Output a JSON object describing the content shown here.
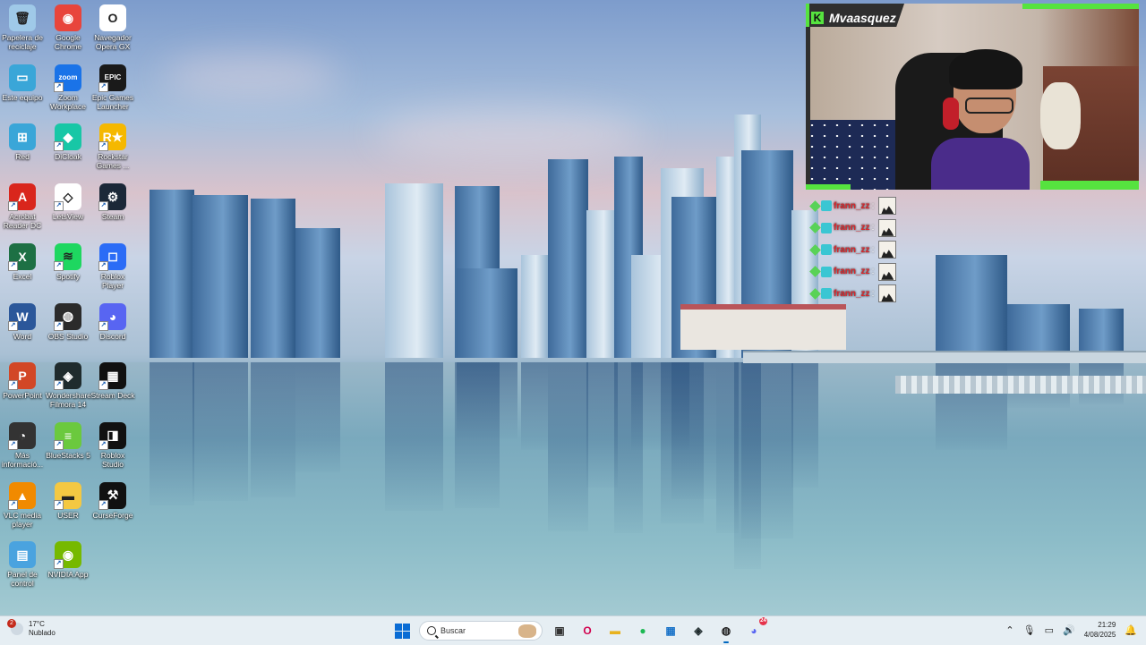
{
  "desktop": {
    "icons": [
      {
        "label": "Papelera de reciclaje",
        "icon": "recycle-bin-icon",
        "color": "#9fc9e8",
        "glyph": "🗑"
      },
      {
        "label": "Google Chrome",
        "icon": "chrome-icon",
        "color": "#e8453c",
        "glyph": "◉"
      },
      {
        "label": "Navegador Opera GX",
        "icon": "opera-gx-icon",
        "color": "#ffffff",
        "glyph": "O"
      },
      {
        "label": "Este equipo",
        "icon": "computer-icon",
        "color": "#3aa6d8",
        "glyph": "▭"
      },
      {
        "label": "Zoom Workplace",
        "icon": "zoom-icon",
        "color": "#1a73e8",
        "glyph": "zoom"
      },
      {
        "label": "Epic Games Launcher",
        "icon": "epic-games-icon",
        "color": "#1a1a1a",
        "glyph": "EPIC"
      },
      {
        "label": "Red",
        "icon": "network-icon",
        "color": "#3aa6d8",
        "glyph": "⊞"
      },
      {
        "label": "DiCloak",
        "icon": "dicloak-icon",
        "color": "#18c7a6",
        "glyph": "◆"
      },
      {
        "label": "Rockstar Games ...",
        "icon": "rockstar-icon",
        "color": "#f5b800",
        "glyph": "R★"
      },
      {
        "label": "Acrobat Reader DC",
        "icon": "acrobat-icon",
        "color": "#d9261c",
        "glyph": "A"
      },
      {
        "label": "LetsView",
        "icon": "letsview-icon",
        "color": "#ffffff",
        "glyph": "◇"
      },
      {
        "label": "Steam",
        "icon": "steam-icon",
        "color": "#1b2838",
        "glyph": "⚙"
      },
      {
        "label": "Excel",
        "icon": "excel-icon",
        "color": "#1d7044",
        "glyph": "X"
      },
      {
        "label": "Spotify",
        "icon": "spotify-icon",
        "color": "#1ed760",
        "glyph": "≋"
      },
      {
        "label": "Roblox Player",
        "icon": "roblox-icon",
        "color": "#2b6cf6",
        "glyph": "◻"
      },
      {
        "label": "Word",
        "icon": "word-icon",
        "color": "#2b579a",
        "glyph": "W"
      },
      {
        "label": "OBS Studio",
        "icon": "obs-icon",
        "color": "#2b2b2b",
        "glyph": "◍"
      },
      {
        "label": "Discord",
        "icon": "discord-icon",
        "color": "#5865f2",
        "glyph": "◕"
      },
      {
        "label": "PowerPoint",
        "icon": "powerpoint-icon",
        "color": "#d24726",
        "glyph": "P"
      },
      {
        "label": "Wondershare Filmora 14",
        "icon": "filmora-icon",
        "color": "#1f2b2d",
        "glyph": "◈"
      },
      {
        "label": "Stream Deck",
        "icon": "stream-deck-icon",
        "color": "#111111",
        "glyph": "▦"
      },
      {
        "label": "Más informació...",
        "icon": "info-icon",
        "color": "#333333",
        "glyph": "◔"
      },
      {
        "label": "BlueStacks 5",
        "icon": "bluestacks-icon",
        "color": "#6bc93e",
        "glyph": "≡"
      },
      {
        "label": "Roblox Studio",
        "icon": "roblox-studio-icon",
        "color": "#111111",
        "glyph": "◨"
      },
      {
        "label": "VLC media player",
        "icon": "vlc-icon",
        "color": "#f18a00",
        "glyph": "▲"
      },
      {
        "label": "USER",
        "icon": "folder-icon",
        "color": "#f4c842",
        "glyph": "▬"
      },
      {
        "label": "CurseForge",
        "icon": "curseforge-icon",
        "color": "#111111",
        "glyph": "⚒"
      },
      {
        "label": "Panel de control",
        "icon": "control-panel-icon",
        "color": "#4aa3df",
        "glyph": "▤"
      },
      {
        "label": "NVIDIA App",
        "icon": "nvidia-icon",
        "color": "#76b900",
        "glyph": "◉"
      }
    ]
  },
  "stream": {
    "streamer_name": "Mvaasquez",
    "accent": "#56e33f",
    "chat": [
      {
        "user": "frann_zz",
        "sep": ":"
      },
      {
        "user": "frann_zz",
        "sep": ":"
      },
      {
        "user": "frann_zz",
        "sep": ":"
      },
      {
        "user": "frann_zz",
        "sep": ":"
      },
      {
        "user": "frann_zz",
        "sep": ":"
      }
    ]
  },
  "taskbar": {
    "weather": {
      "temp": "17°C",
      "condition": "Nublado",
      "badge": "2"
    },
    "search_placeholder": "Buscar",
    "apps": [
      {
        "name": "task-view",
        "glyph": "▣",
        "color": "#333333",
        "active": false
      },
      {
        "name": "opera-gx",
        "glyph": "O",
        "color": "#d1004d",
        "active": false
      },
      {
        "name": "file-explorer",
        "glyph": "▬",
        "color": "#e8b21f",
        "active": false
      },
      {
        "name": "spotify",
        "glyph": "●",
        "color": "#1db954",
        "active": false
      },
      {
        "name": "microsoft-store",
        "glyph": "▦",
        "color": "#1a73c8",
        "active": false
      },
      {
        "name": "filmora",
        "glyph": "◈",
        "color": "#1f2b2d",
        "active": false
      },
      {
        "name": "obs-studio",
        "glyph": "◍",
        "color": "#1e1e1e",
        "active": true
      },
      {
        "name": "discord",
        "glyph": "◕",
        "color": "#5865f2",
        "active": false
      }
    ],
    "discord_badge": "24",
    "clock": {
      "time": "21:29",
      "date": "4/08/2025"
    }
  }
}
